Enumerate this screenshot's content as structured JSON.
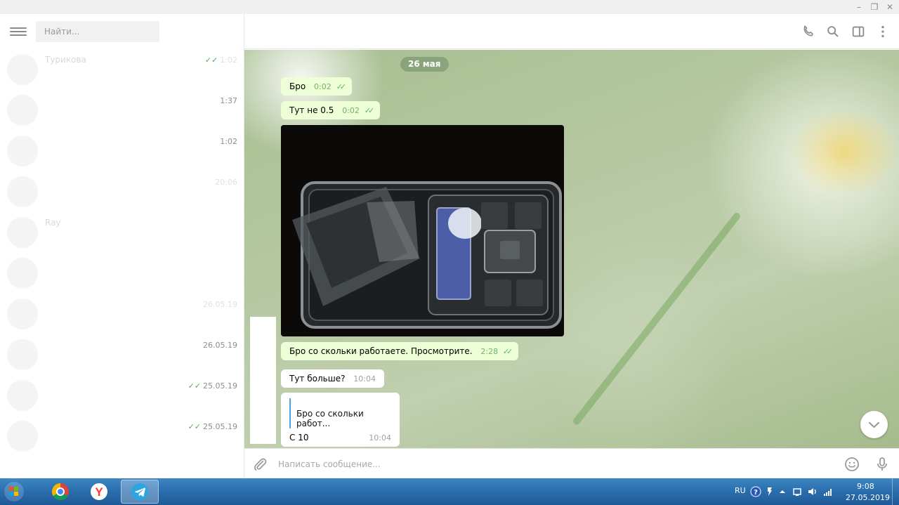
{
  "window": {
    "minimize_icon": "minimize-icon",
    "restore_icon": "restore-icon",
    "close_icon": "close-icon"
  },
  "sidebar": {
    "search_placeholder": "Найти...",
    "chats": [
      {
        "name": "Турикова",
        "preview": "",
        "time": "1:02",
        "read": true,
        "faint_time": true
      },
      {
        "name": "",
        "preview": "",
        "time": "1:37",
        "read": false,
        "faint_time": false
      },
      {
        "name": "",
        "preview": "",
        "time": "1:02",
        "read": false,
        "faint_time": false
      },
      {
        "name": "",
        "preview": "",
        "time": "20:06",
        "read": false,
        "faint_time": true
      },
      {
        "name": "Ray",
        "preview": "",
        "time": "",
        "read": false,
        "faint_time": true
      },
      {
        "name": "",
        "preview": "",
        "time": "",
        "read": false,
        "faint_time": false
      },
      {
        "name": "",
        "preview": "",
        "time": "26.05.19",
        "read": false,
        "faint_time": true
      },
      {
        "name": "",
        "preview": "",
        "time": "26.05.19",
        "read": false,
        "faint_time": false
      },
      {
        "name": "",
        "preview": "",
        "time": "25.05.19",
        "read": true,
        "faint_time": false
      },
      {
        "name": "",
        "preview": "",
        "time": "25.05.19",
        "read": true,
        "faint_time": false
      }
    ]
  },
  "chat": {
    "date_label": "26 мая",
    "messages": [
      {
        "text": "Бро",
        "time": "0:02",
        "dir": "out"
      },
      {
        "text": "Тут не 0.5",
        "time": "0:02",
        "dir": "out"
      },
      {
        "text": "Бро со скольки работаете. Просмотрите.",
        "time": "2:28",
        "dir": "out"
      },
      {
        "text": "Тут больше?",
        "time": "10:04",
        "dir": "in"
      },
      {
        "reply_to": "Бро со скольки работ...",
        "text": "С 10",
        "time": "10:04",
        "dir": "in"
      }
    ],
    "composer_placeholder": "Написать сообщение..."
  },
  "taskbar": {
    "language": "RU",
    "clock_time": "9:08",
    "clock_date": "27.05.2019"
  },
  "colors": {
    "accent": "#4fae4e",
    "outgoing_bubble": "#eefed6",
    "date_pill": "#6e8c64",
    "taskbar": "#2b6fae"
  }
}
